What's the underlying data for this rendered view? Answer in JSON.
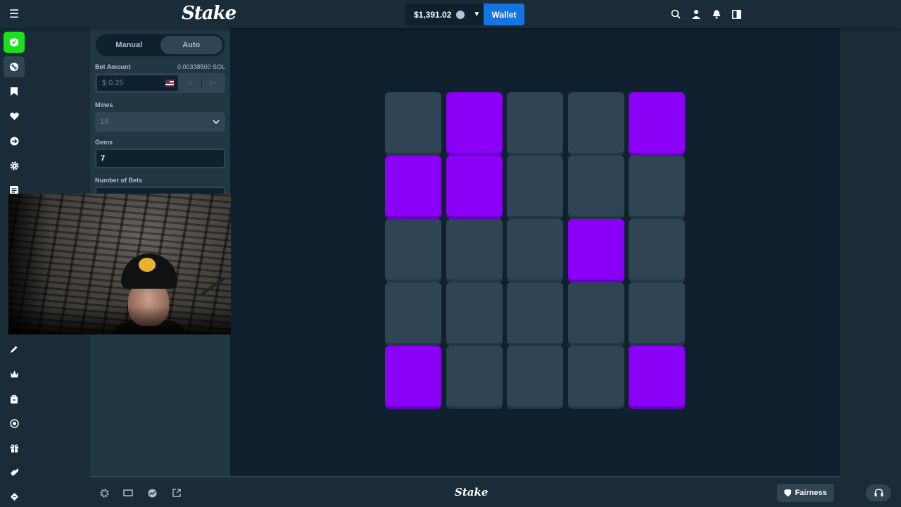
{
  "topbar": {
    "logo": "Stake",
    "balance": "$1,391.02",
    "wallet_label": "Wallet"
  },
  "panel": {
    "modes": [
      {
        "label": "Manual",
        "active": false
      },
      {
        "label": "Auto",
        "active": true
      }
    ],
    "bet_amount_label": "Bet Amount",
    "bet_amount_crypto": "0.00338500 SOL",
    "bet_amount_placeholder": "$ 0.25",
    "half_label": "½",
    "double_label": "2×",
    "mines_label": "Mines",
    "mines_value": "18",
    "gems_label": "Gems",
    "gems_value": "7",
    "bets_label": "Number of Bets"
  },
  "grid": {
    "rows": 5,
    "cols": 5,
    "tiles": [
      "plain",
      "gem",
      "plain",
      "plain",
      "gem",
      "gem",
      "gem",
      "plain",
      "plain",
      "plain",
      "plain",
      "plain",
      "plain",
      "gem",
      "plain",
      "plain",
      "plain",
      "plain",
      "plain",
      "plain",
      "gem",
      "plain",
      "plain",
      "plain",
      "gem"
    ],
    "gem_color": "#8a00f7",
    "tile_color": "#2f4553"
  },
  "bottombar": {
    "logo": "Stake",
    "fairness_label": "Fairness"
  },
  "icons": {
    "rail": [
      "sportsbook-icon",
      "casino-icon",
      "bookmark-icon",
      "heart-icon",
      "arrow-right-icon",
      "gear-icon",
      "document-icon",
      "pen-icon",
      "crown-icon",
      "bag-icon",
      "target-icon",
      "gift-icon",
      "hand-icon",
      "diamond-icon"
    ],
    "top": [
      "search-icon",
      "user-icon",
      "bell-icon",
      "sidebar-toggle-icon"
    ],
    "bottom": [
      "settings-icon",
      "theatre-mode-icon",
      "stats-icon",
      "popout-icon"
    ]
  },
  "colors": {
    "accent_blue": "#1475e1",
    "brand_green": "#1be01c",
    "bg": "#1a2c38",
    "game_bg": "#0f212e"
  }
}
